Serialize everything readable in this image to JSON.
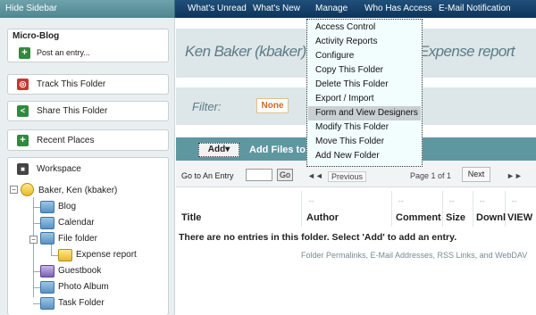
{
  "sidebar": {
    "hide_label": "Hide Sidebar",
    "microblog_title": "Micro-Blog",
    "post_entry": "Post an entry...",
    "track": "Track This Folder",
    "share": "Share This Folder",
    "recent": "Recent Places",
    "workspace": "Workspace",
    "tree": {
      "root": "Baker, Ken (kbaker)",
      "items": [
        "Blog",
        "Calendar",
        "File folder",
        "Expense report",
        "Guestbook",
        "Photo Album",
        "Task Folder"
      ]
    }
  },
  "topnav": {
    "items": [
      "What's Unread",
      "What's New",
      "Manage",
      "Who Has Access",
      "E-Mail Notification"
    ]
  },
  "main": {
    "crumb_left": "Ken Baker (kbaker) >",
    "crumb_right": "Expense report",
    "filter_label": "Filter:",
    "filter_value": "None",
    "add_label": "Add",
    "add_files": "Add Files to F",
    "goto_label": "Go to An Entry",
    "go_label": "Go",
    "previous": "Previous",
    "page_info": "Page 1 of 1",
    "next": "Next",
    "columns": [
      "Title",
      "Author",
      "Comment",
      "Size",
      "Downl",
      "VIEW"
    ],
    "empty_message": "There are no entries in this folder.   Select 'Add' to add an entry.",
    "footer": "Folder Permalinks, E-Mail Addresses, RSS Links, and WebDAV"
  },
  "menu": {
    "items": [
      "Access Control",
      "Activity Reports",
      "Configure",
      "Copy This Folder",
      "Delete This Folder",
      "Export / Import",
      "Form and View Designers",
      "Modify This Folder",
      "Move This Folder",
      "Add New Folder"
    ],
    "highlighted_index": 6
  },
  "colors": {
    "topnav": "#0e355a",
    "teal_bar": "#5f97a1",
    "panel_bg": "#dde6e8",
    "menu_bg": "#f2fdfd"
  }
}
